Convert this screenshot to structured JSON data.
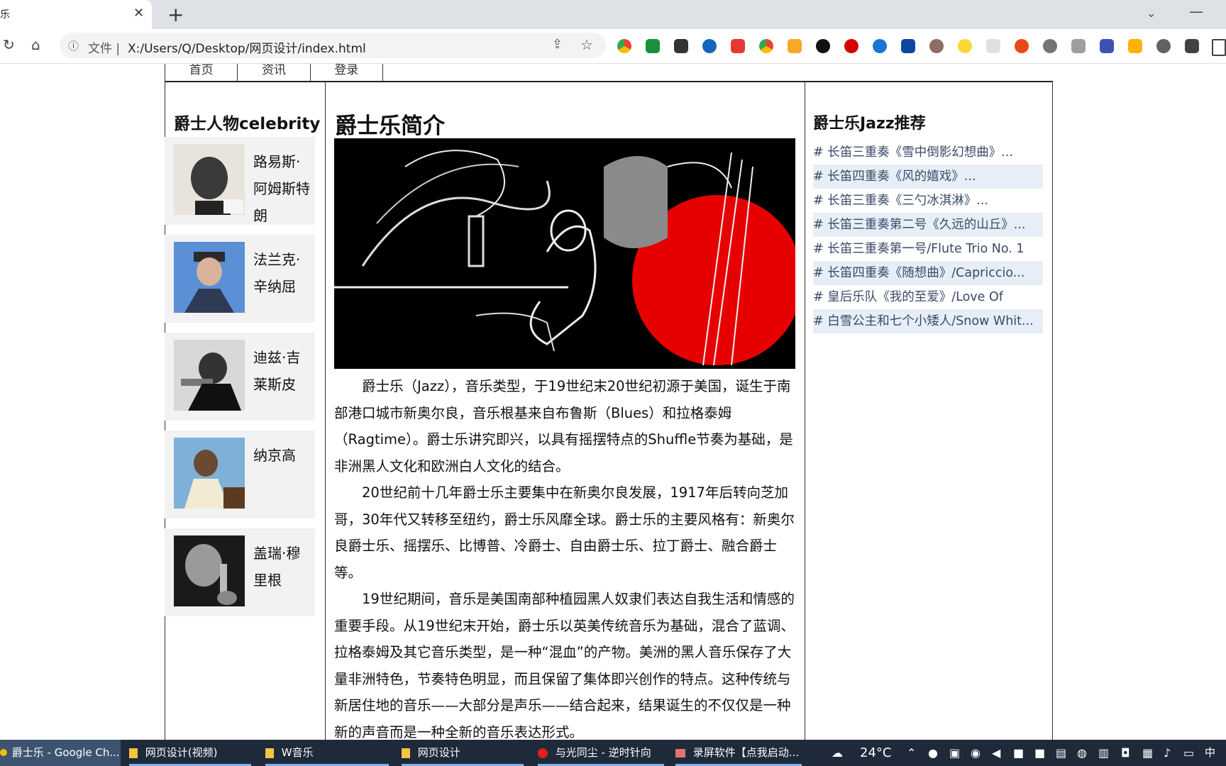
{
  "browser": {
    "tab_title": "乐",
    "tab_close": "✕",
    "new_tab": "+",
    "tab_menu": "⌄",
    "minimize": "—",
    "back": "↻",
    "home": "⌂",
    "info": "ⓘ",
    "file_label": "文件 |",
    "url": "X:/Users/Q/Desktop/网页设计/index.html",
    "share": "⇪",
    "star": "☆"
  },
  "nav": {
    "items": [
      "首页",
      "资讯",
      "登录"
    ]
  },
  "left": {
    "heading": "爵士人物celebrity",
    "people": [
      {
        "name": "路易斯·阿姆斯特朗"
      },
      {
        "name": "法兰克·辛纳屈"
      },
      {
        "name": "迪兹·吉莱斯皮"
      },
      {
        "name": "纳京高"
      },
      {
        "name": "盖瑞·穆里根"
      }
    ]
  },
  "main": {
    "heading": "爵士乐简介",
    "paragraphs": [
      "爵士乐（Jazz），音乐类型，于19世纪末20世纪初源于美国，诞生于南部港口城市新奥尔良，音乐根基来自布鲁斯（Blues）和拉格泰姆（Ragtime）。爵士乐讲究即兴，以具有摇摆特点的Shuffle节奏为基础，是非洲黑人文化和欧洲白人文化的结合。",
      "20世纪前十几年爵士乐主要集中在新奥尔良发展，1917年后转向芝加哥，30年代又转移至纽约，爵士乐风靡全球。爵士乐的主要风格有：新奥尔良爵士乐、摇摆乐、比博普、冷爵士、自由爵士乐、拉丁爵士、融合爵士等。",
      "19世纪期间，音乐是美国南部种植园黑人奴隶们表达自我生活和情感的重要手段。从19世纪末开始，爵士乐以英美传统音乐为基础，混合了蓝调、拉格泰姆及其它音乐类型，是一种“混血”的产物。美洲的黑人音乐保存了大量非洲特色，节奏特色明显，而且保留了集体即兴创作的特点。这种传统与新居住地的音乐——大部分是声乐——结合起来，结果诞生的不仅仅是一种新的声音而是一种全新的音乐表达形式。"
    ]
  },
  "right": {
    "heading": "爵士乐Jazz推荐",
    "items": [
      "# 长笛三重奏《雪中倒影幻想曲》...",
      "# 长笛四重奏《风的嬉戏》...",
      "# 长笛三重奏《三勺冰淇淋》...",
      "# 长笛三重奏第二号《久远的山丘》...",
      "# 长笛三重奏第一号/Flute Trio No. 1",
      "# 长笛四重奏《随想曲》/Capriccio...",
      "# 皇后乐队《我的至爱》/Love Of",
      "# 白雪公主和七个小矮人/Snow Whit..."
    ]
  },
  "taskbar": {
    "tasks": [
      "爵士乐 - Google Ch...",
      "网页设计(视频)",
      "W音乐",
      "网页设计",
      "与光同尘 - 逆时针向",
      "录屏软件【点我启动..."
    ],
    "weather": "24°C",
    "ime": "中"
  }
}
